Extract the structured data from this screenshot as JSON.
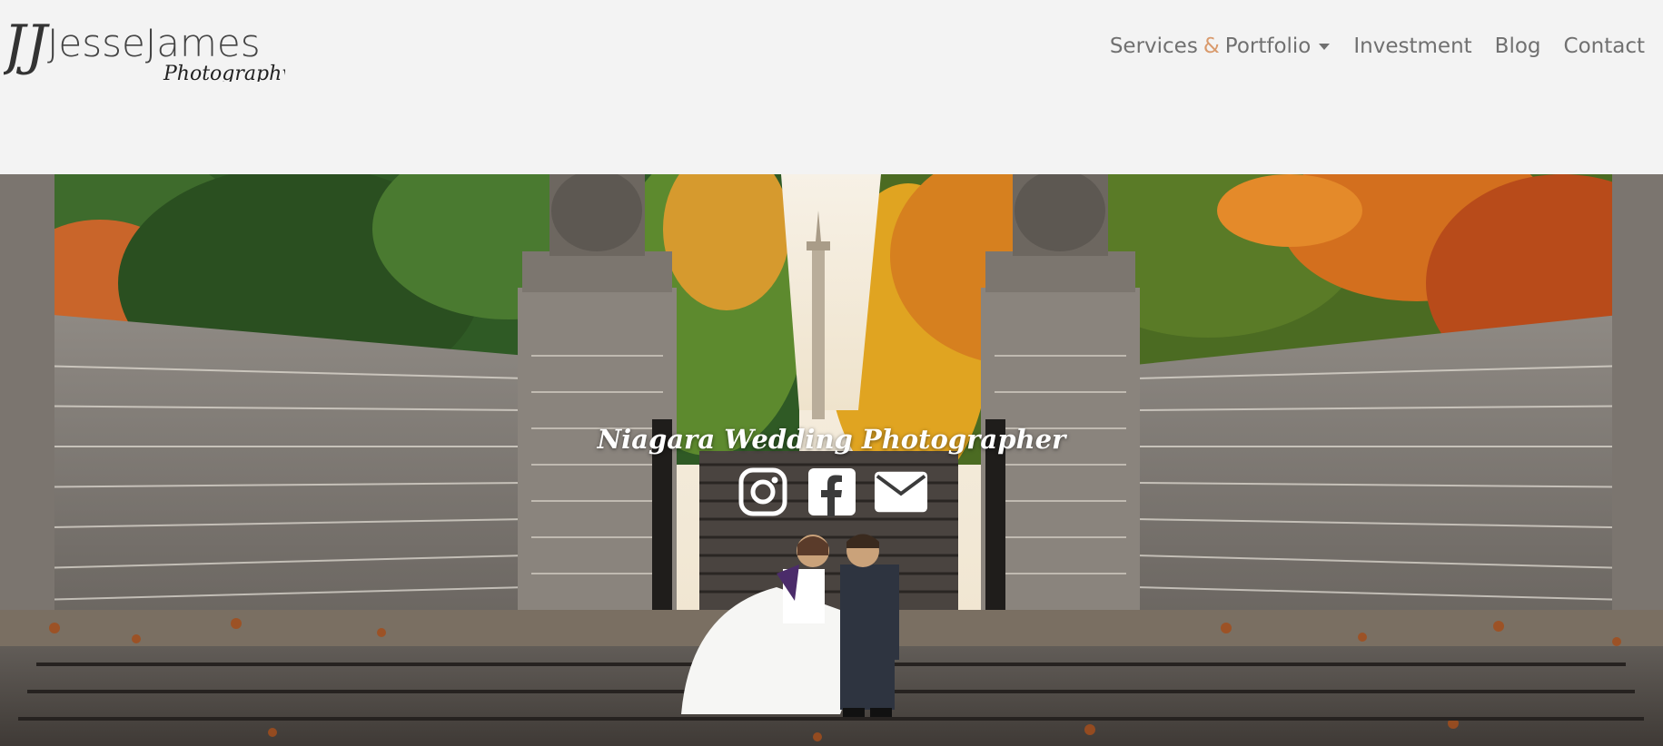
{
  "header": {
    "logo": {
      "primary": "JesseJames",
      "secondary": "Photography",
      "monogram": "JJ"
    },
    "nav": {
      "services_word": "Services",
      "ampersand": "&",
      "portfolio_word": "Portfolio",
      "dropdown_icon": "chevron-down-icon",
      "investment": "Investment",
      "blog": "Blog",
      "contact": "Contact"
    }
  },
  "hero": {
    "title": "Niagara Wedding Photographer",
    "social": [
      {
        "icon": "instagram-icon"
      },
      {
        "icon": "facebook-icon"
      },
      {
        "icon": "email-icon"
      }
    ]
  },
  "colors": {
    "background": "#f3f3f3",
    "nav_text": "#707070",
    "accent": "#d99a6c",
    "hero_text": "#ffffff"
  }
}
